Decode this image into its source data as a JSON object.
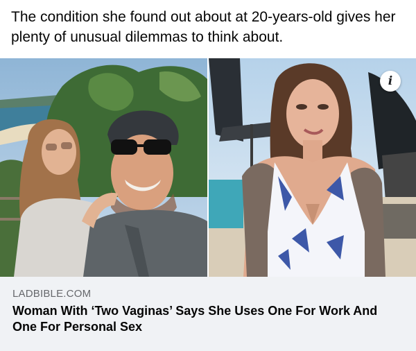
{
  "post": {
    "text": "The condition she found out about at 20-years-old gives her plenty of unusual dilemmas to think about."
  },
  "link_preview": {
    "domain": "LADBIBLE.COM",
    "headline": "Woman With ‘Two Vaginas’ Says She Uses One For Work And One For Personal Sex"
  },
  "icons": {
    "info": "info-icon"
  },
  "info_glyph": "i",
  "colors": {
    "page_bg": "#ffffff",
    "preview_bg": "#f0f2f5",
    "domain_text": "#65676b",
    "headline_text": "#050505"
  }
}
